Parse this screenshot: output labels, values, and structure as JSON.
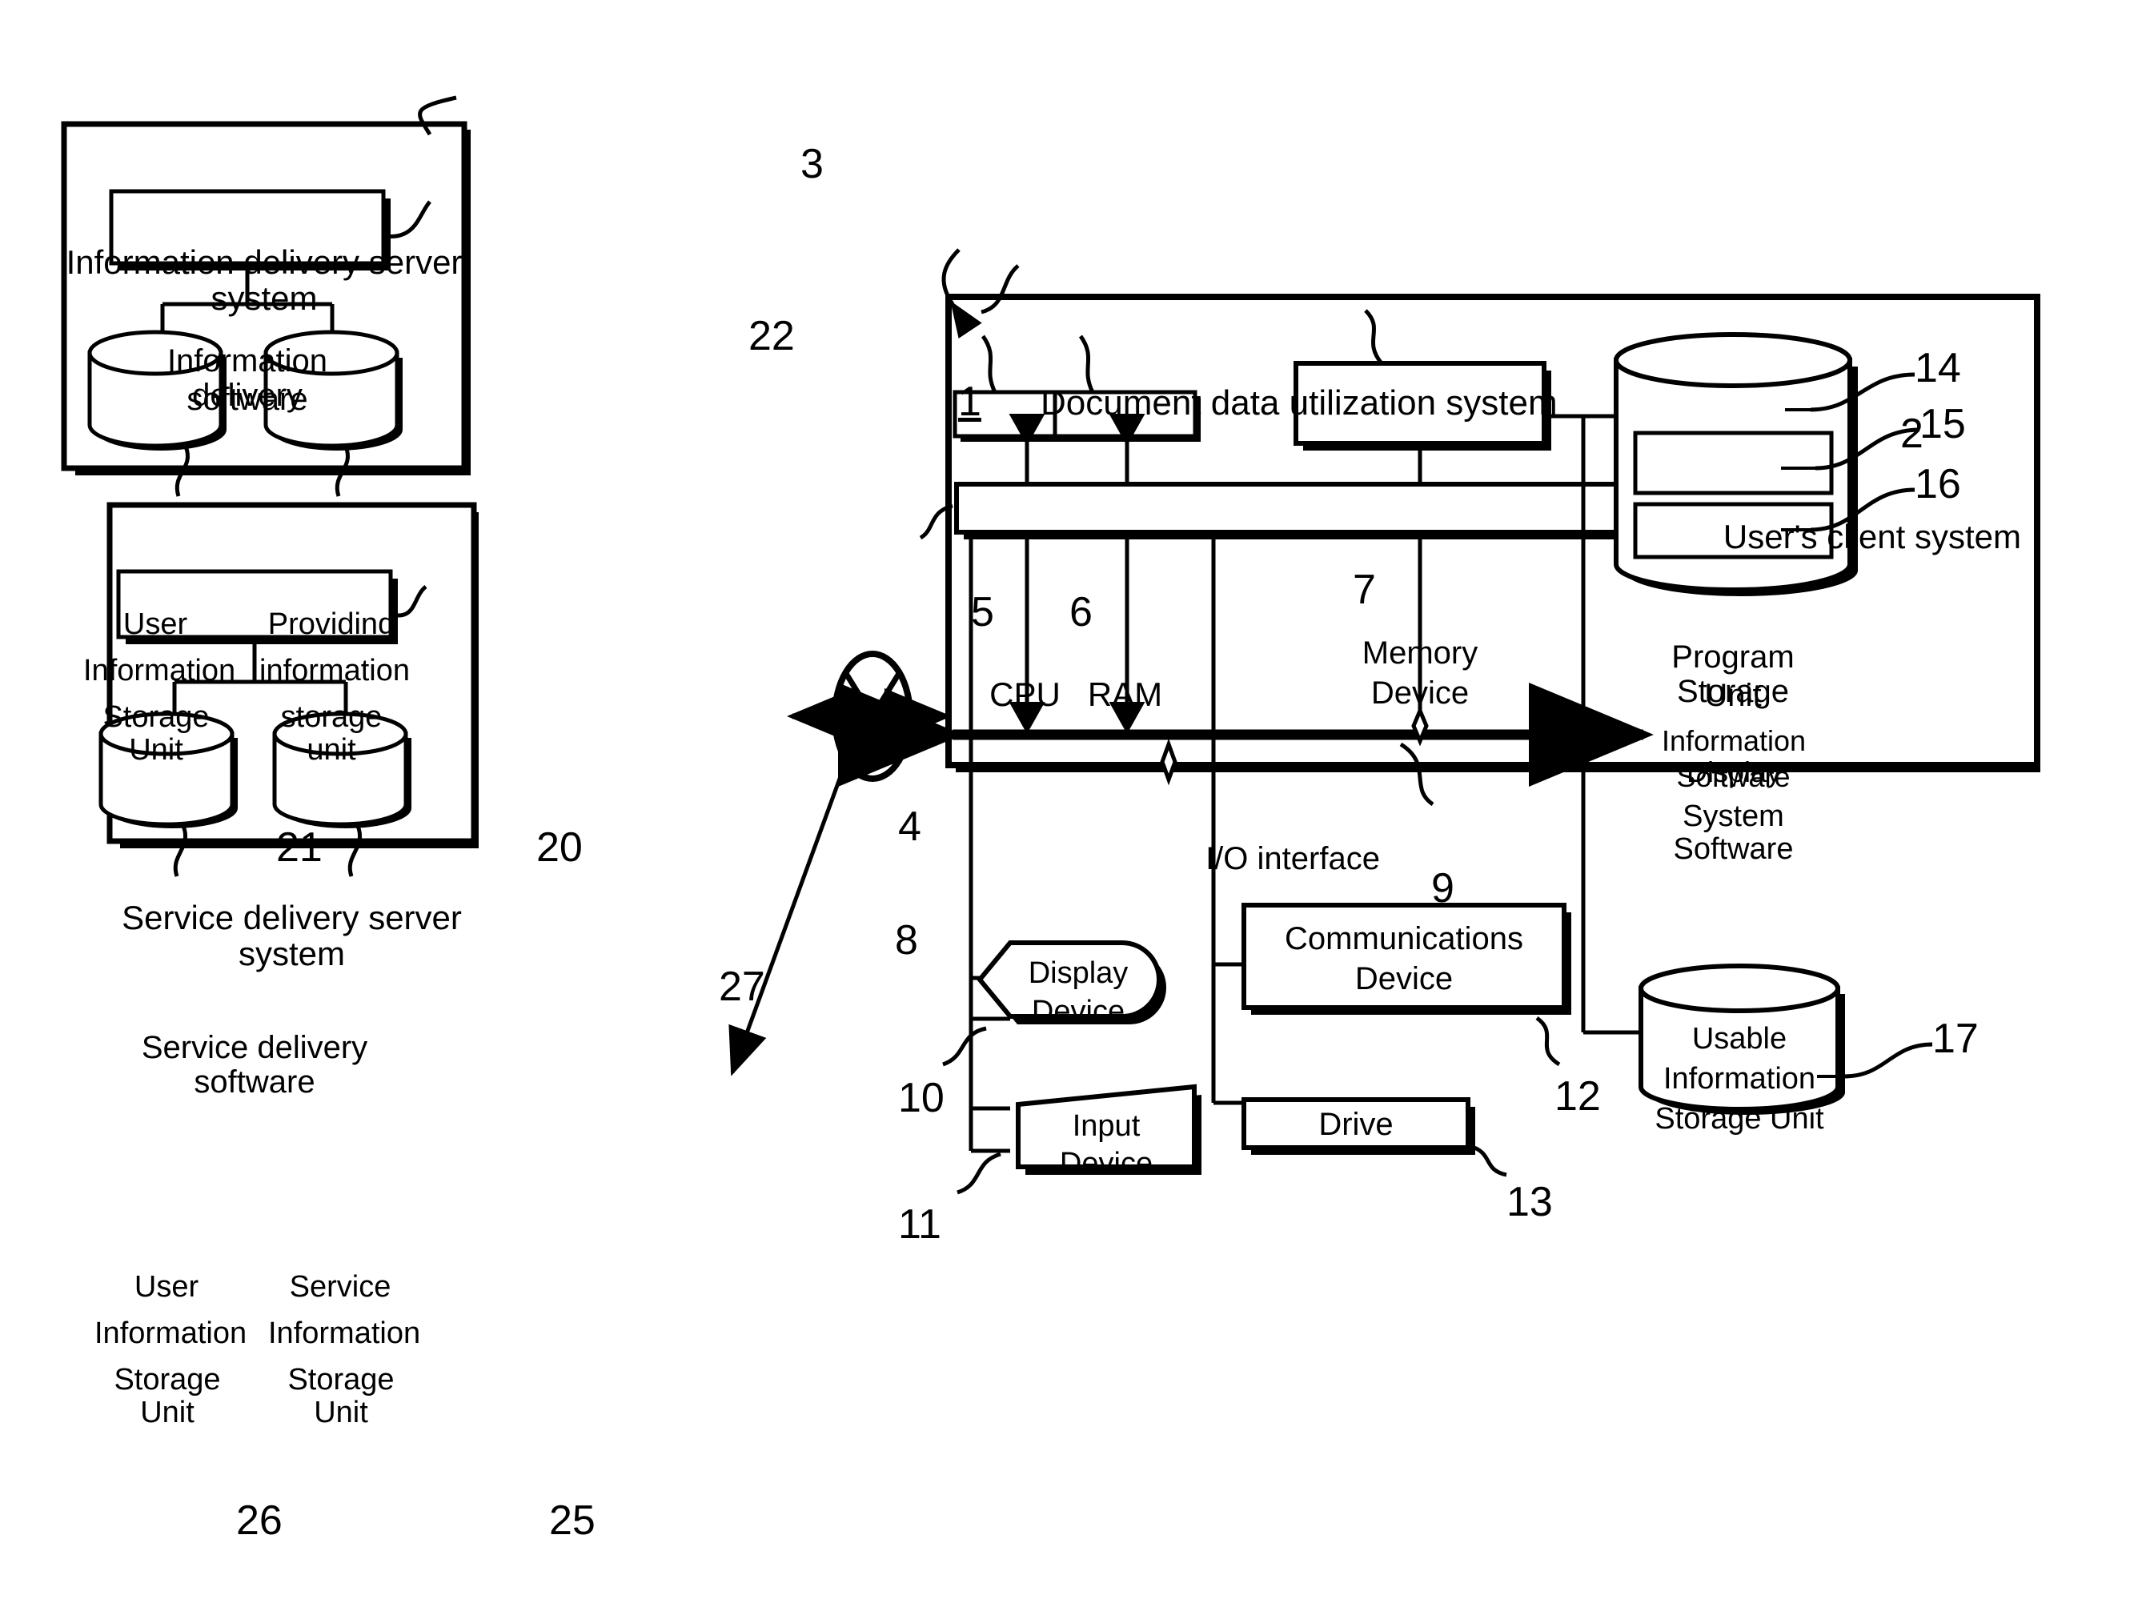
{
  "figure": {
    "title_ref": "1",
    "title": "Document data utilization system"
  },
  "info_server": {
    "ref": "3",
    "title": "Information delivery server system",
    "software": {
      "ref": "22",
      "label": "Information delivery\nsoftware",
      "line1": "Information delivery",
      "line2": "software"
    },
    "stores": [
      {
        "ref": "21",
        "line1": "User",
        "line2": "Information",
        "line3": "Storage Unit"
      },
      {
        "ref": "20",
        "line1": "Providing",
        "line2": "information",
        "line3": "storage unit"
      }
    ]
  },
  "service_server": {
    "ref": "27",
    "title": "Service delivery server system",
    "software": {
      "label": "Service delivery software"
    },
    "stores": [
      {
        "ref": "26",
        "line1": "User",
        "line2": "Information",
        "line3": "Storage Unit"
      },
      {
        "ref": "25",
        "line1": "Service",
        "line2": "Information",
        "line3": "Storage Unit"
      }
    ]
  },
  "network": {
    "ref": "4",
    "icon": "network-cloud-x-icon"
  },
  "client": {
    "ref": "2",
    "title": "User's client system",
    "cpu": {
      "ref": "5",
      "label": "CPU"
    },
    "ram": {
      "ref": "6",
      "label": "RAM"
    },
    "memory_device": {
      "ref": "7",
      "line1": "Memory",
      "line2": "Device"
    },
    "bus": {
      "ref": "9",
      "name": "system-bus"
    },
    "io_interface": {
      "ref": "8",
      "label": "I/O interface"
    },
    "display_device": {
      "ref": "10",
      "line1": "Display",
      "line2": "Device"
    },
    "input_device": {
      "ref": "11",
      "line1": "Input",
      "line2": "Device"
    },
    "communications_device": {
      "ref": "12",
      "line1": "Communications",
      "line2": "Device"
    },
    "drive": {
      "ref": "13",
      "label": "Drive"
    },
    "program_storage": {
      "ref": "14",
      "line1": "Program Storage",
      "line2": "Unit",
      "items": [
        {
          "ref": "15",
          "line1": "Information Display",
          "line2": "Software"
        },
        {
          "ref": "16",
          "label": "System Software"
        }
      ]
    },
    "usable_storage": {
      "ref": "17",
      "line1": "Usable",
      "line2": "Information",
      "line3": "Storage Unit"
    }
  },
  "colors": {
    "ink": "#000000",
    "paper": "#ffffff"
  }
}
